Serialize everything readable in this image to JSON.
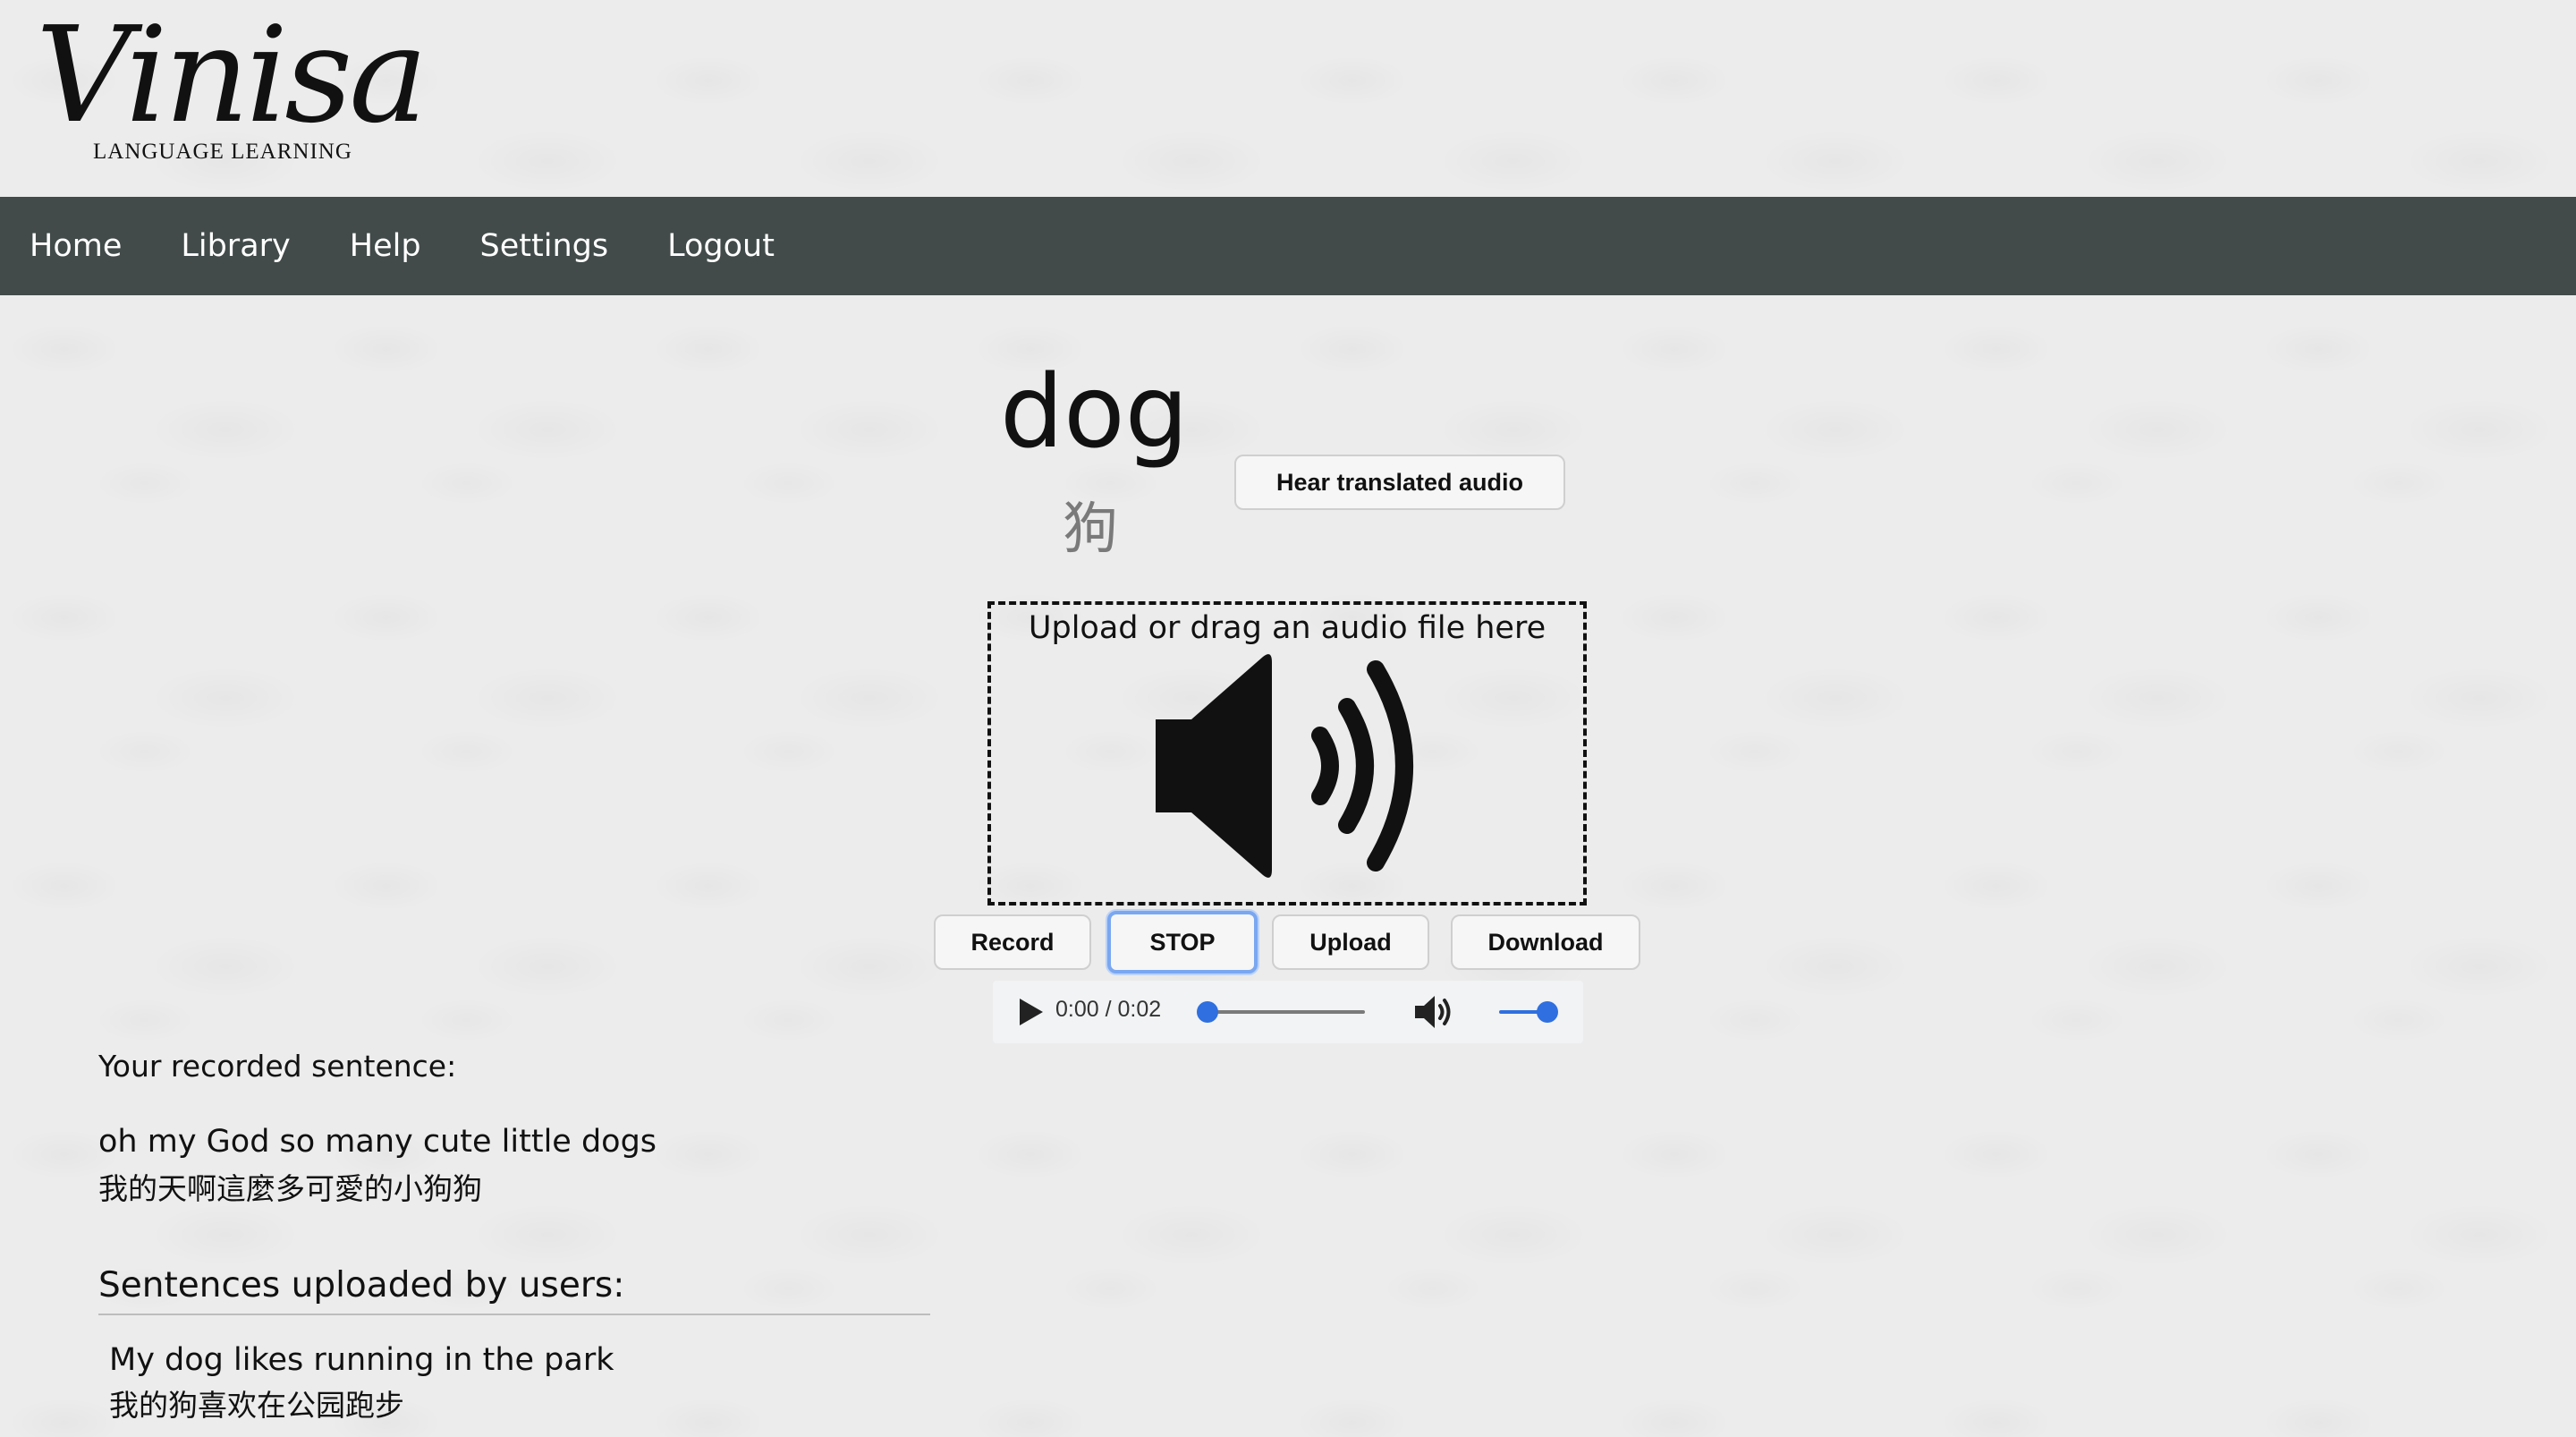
{
  "logo": {
    "script": "Vinisa",
    "subtitle": "LANGUAGE LEARNING"
  },
  "nav": {
    "items": [
      {
        "label": "Home"
      },
      {
        "label": "Library"
      },
      {
        "label": "Help"
      },
      {
        "label": "Settings"
      },
      {
        "label": "Logout"
      }
    ]
  },
  "word": {
    "english": "dog",
    "translation": "狗"
  },
  "buttons": {
    "hear_translated": "Hear translated audio",
    "record": "Record",
    "stop": "STOP",
    "upload": "Upload",
    "download": "Download"
  },
  "dropzone": {
    "label": "Upload or drag an audio file here",
    "icon": "speaker-icon"
  },
  "audio_player": {
    "time": "0:00 / 0:02",
    "progress": 0,
    "volume": 1,
    "accent_color": "#2f6fe0"
  },
  "recorded": {
    "heading": "Your recorded sentence:",
    "english": "oh my God so many cute little dogs",
    "chinese": "我的天啊這麼多可愛的小狗狗"
  },
  "uploaded": {
    "heading": "Sentences uploaded by users:",
    "items": [
      {
        "english": "My dog likes running in the park",
        "chinese": "我的狗喜欢在公园跑步"
      }
    ]
  },
  "colors": {
    "navbar": "#424a4a",
    "focus_outline": "#7aa7f0"
  }
}
